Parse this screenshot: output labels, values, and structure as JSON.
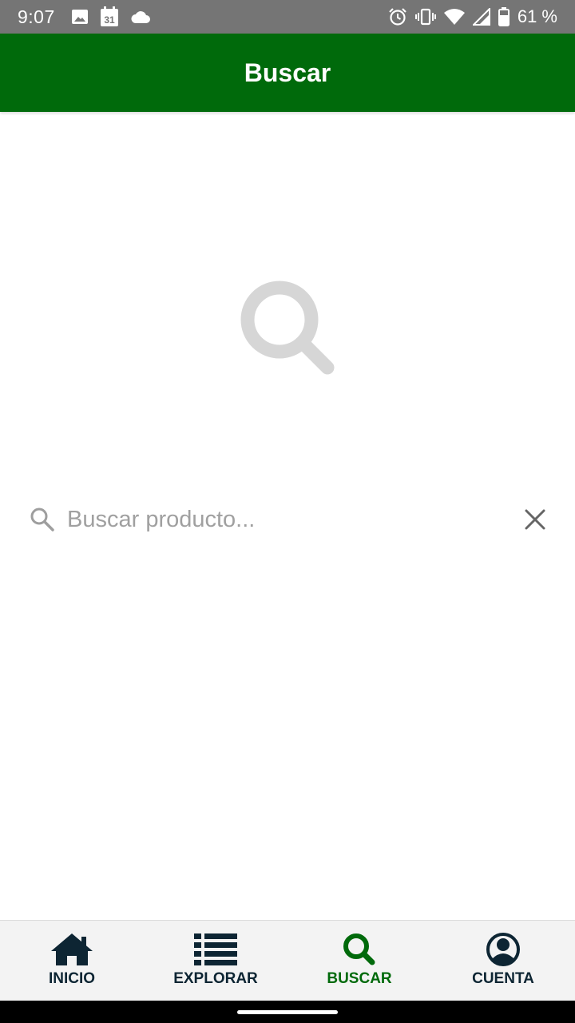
{
  "status_bar": {
    "time": "9:07",
    "calendar_day": "31",
    "battery_percent": "61 %",
    "icons": [
      "image-icon",
      "calendar-icon",
      "cloud-icon",
      "alarm-icon",
      "vibrate-icon",
      "wifi-icon",
      "signal-icon",
      "battery-icon"
    ]
  },
  "app_bar": {
    "title": "Buscar",
    "color": "#006A0B"
  },
  "hero": {
    "icon": "search-icon",
    "color": "#d6d6d6"
  },
  "search": {
    "placeholder": "Buscar producto...",
    "value": "",
    "leading_icon": "search-icon",
    "trailing_icon": "close-icon"
  },
  "bottom_nav": {
    "active_color": "#006A0B",
    "inactive_color": "#0d2533",
    "items": [
      {
        "label": "INICIO",
        "icon": "home-icon",
        "active": false
      },
      {
        "label": "EXPLORAR",
        "icon": "list-icon",
        "active": false
      },
      {
        "label": "BUSCAR",
        "icon": "search-icon",
        "active": true
      },
      {
        "label": "CUENTA",
        "icon": "account-icon",
        "active": false
      }
    ]
  }
}
